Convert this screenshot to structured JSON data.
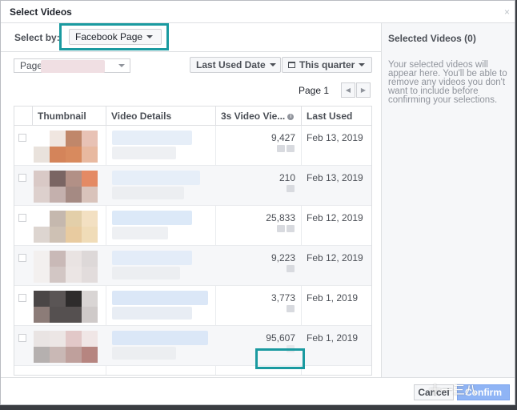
{
  "dialog": {
    "title": "Select Videos",
    "close_glyph": "×"
  },
  "filters": {
    "select_by_label": "Select by:",
    "select_by_value": "Facebook Page",
    "page_select_value": "Page",
    "sort_value": "Last Used Date",
    "date_range_value": "This quarter"
  },
  "pager": {
    "label": "Page 1",
    "prev_glyph": "◀",
    "next_glyph": "▶"
  },
  "table": {
    "columns": [
      "Thumbnail",
      "Video Details",
      "3s Video Vie...",
      "Last Used"
    ],
    "info_glyph": "i",
    "rows": [
      {
        "views": "9,427",
        "last_used": "Feb 13, 2019"
      },
      {
        "views": "210",
        "last_used": "Feb 13, 2019"
      },
      {
        "views": "25,833",
        "last_used": "Feb 12, 2019"
      },
      {
        "views": "9,223",
        "last_used": "Feb 12, 2019"
      },
      {
        "views": "3,773",
        "last_used": "Feb 1, 2019"
      },
      {
        "views": "95,607",
        "last_used": "Feb 1, 2019"
      }
    ]
  },
  "sidebar": {
    "title": "Selected Videos (0)",
    "hint": "Your selected videos will appear here. You'll be able to remove any videos you don't want to include before confirming your selections."
  },
  "footer": {
    "cancel_label": "Cancel",
    "confirm_label": "Confirm"
  },
  "watermark": "十一三八",
  "colors": {
    "highlight": "#1a9aa0",
    "confirm_button": "#8fb4f5"
  }
}
